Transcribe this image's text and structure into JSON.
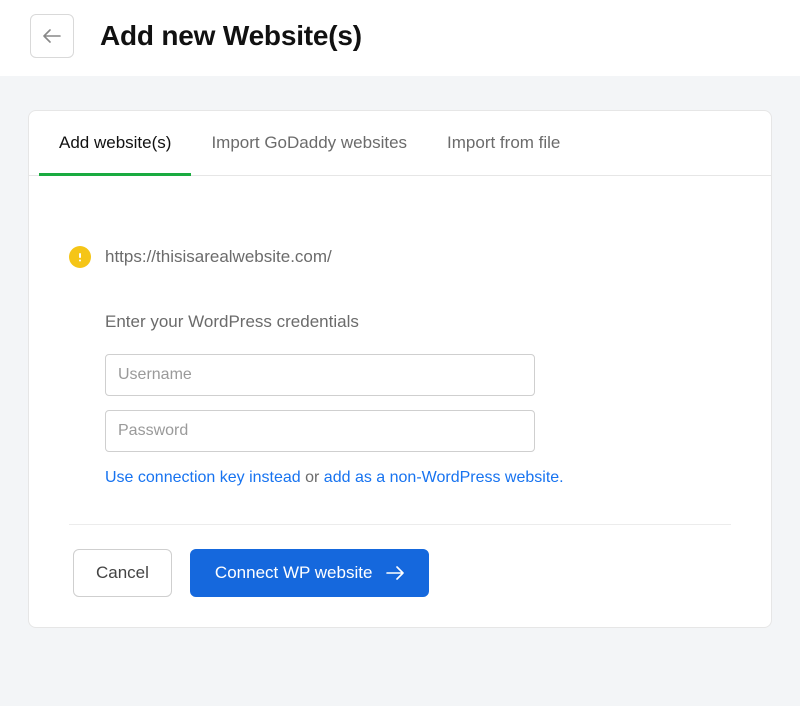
{
  "header": {
    "title": "Add new Website(s)"
  },
  "tabs": [
    {
      "label": "Add website(s)",
      "active": true
    },
    {
      "label": "Import GoDaddy websites",
      "active": false
    },
    {
      "label": "Import from file",
      "active": false
    }
  ],
  "site": {
    "url": "https://thisisarealwebsite.com/"
  },
  "form": {
    "instruction": "Enter your WordPress credentials",
    "username_placeholder": "Username",
    "password_placeholder": "Password",
    "link_key": "Use connection key instead",
    "or_text": " or ",
    "link_nonwp": "add as a non-WordPress website."
  },
  "actions": {
    "cancel": "Cancel",
    "connect": "Connect WP website"
  }
}
